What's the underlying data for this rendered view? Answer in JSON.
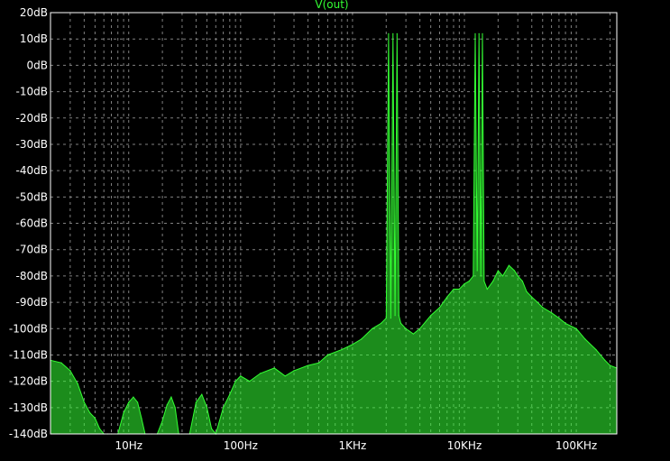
{
  "chart_data": {
    "type": "line",
    "title": "V(out)",
    "xlabel": "",
    "ylabel": "",
    "x_scale": "log",
    "xlim": [
      2,
      230000
    ],
    "ylim": [
      -140,
      20
    ],
    "grid": true,
    "x_ticks": [
      "10Hz",
      "100Hz",
      "1KHz",
      "10KHz",
      "100KHz"
    ],
    "x_tick_values": [
      10,
      100,
      1000,
      10000,
      100000
    ],
    "y_ticks": [
      "20dB",
      "10dB",
      "0dB",
      "-10dB",
      "-20dB",
      "-30dB",
      "-40dB",
      "-50dB",
      "-60dB",
      "-70dB",
      "-80dB",
      "-90dB",
      "-100dB",
      "-110dB",
      "-120dB",
      "-130dB",
      "-140dB"
    ],
    "y_tick_values": [
      20,
      10,
      0,
      -10,
      -20,
      -30,
      -40,
      -50,
      -60,
      -70,
      -80,
      -90,
      -100,
      -110,
      -120,
      -130,
      -140
    ],
    "series": [
      {
        "color": "#33ff33",
        "x": [
          2,
          2.5,
          3,
          3.5,
          4,
          4.5,
          5,
          5.5,
          6,
          6.5,
          7,
          8,
          9,
          10,
          11,
          12,
          13,
          14,
          16,
          18,
          20,
          22,
          24,
          26,
          28,
          30,
          35,
          40,
          45,
          50,
          55,
          60,
          70,
          80,
          90,
          100,
          120,
          150,
          200,
          250,
          300,
          400,
          500,
          600,
          800,
          1000,
          1200,
          1500,
          1800,
          2000,
          2100,
          2200,
          2300,
          2400,
          2500,
          2600,
          2700,
          3000,
          3500,
          4000,
          5000,
          6000,
          7000,
          8000,
          9000,
          10000,
          11000,
          12000,
          12500,
          13000,
          13500,
          14000,
          14500,
          15000,
          16000,
          18000,
          20000,
          22000,
          25000,
          28000,
          30000,
          33000,
          36000,
          40000,
          45000,
          50000,
          60000,
          70000,
          80000,
          100000,
          120000,
          150000,
          180000,
          200000,
          230000
        ],
        "y": [
          -112,
          -113,
          -116,
          -121,
          -128,
          -132,
          -134,
          -138,
          -145,
          -150,
          -150,
          -142,
          -132,
          -128,
          -126,
          -128,
          -134,
          -150,
          -150,
          -145,
          -135,
          -129,
          -126,
          -130,
          -140,
          -148,
          -140,
          -128,
          -125,
          -130,
          -138,
          -140,
          -130,
          -125,
          -120,
          -118,
          -120,
          -117,
          -115,
          -118,
          -116,
          -114,
          -113,
          -110,
          -108,
          -106,
          -104,
          -100,
          -98,
          -96,
          12,
          -96,
          12,
          -95,
          12,
          -95,
          -98,
          -100,
          -102,
          -100,
          -95,
          -92,
          -88,
          -85,
          -85,
          -83,
          -82,
          -80,
          12,
          -78,
          12,
          -80,
          12,
          -82,
          -85,
          -82,
          -78,
          -80,
          -76,
          -78,
          -80,
          -82,
          -86,
          -88,
          -90,
          -92,
          -94,
          -96,
          -98,
          -100,
          -104,
          -108,
          -112,
          -114,
          -115
        ]
      }
    ],
    "fill_floor": true
  }
}
